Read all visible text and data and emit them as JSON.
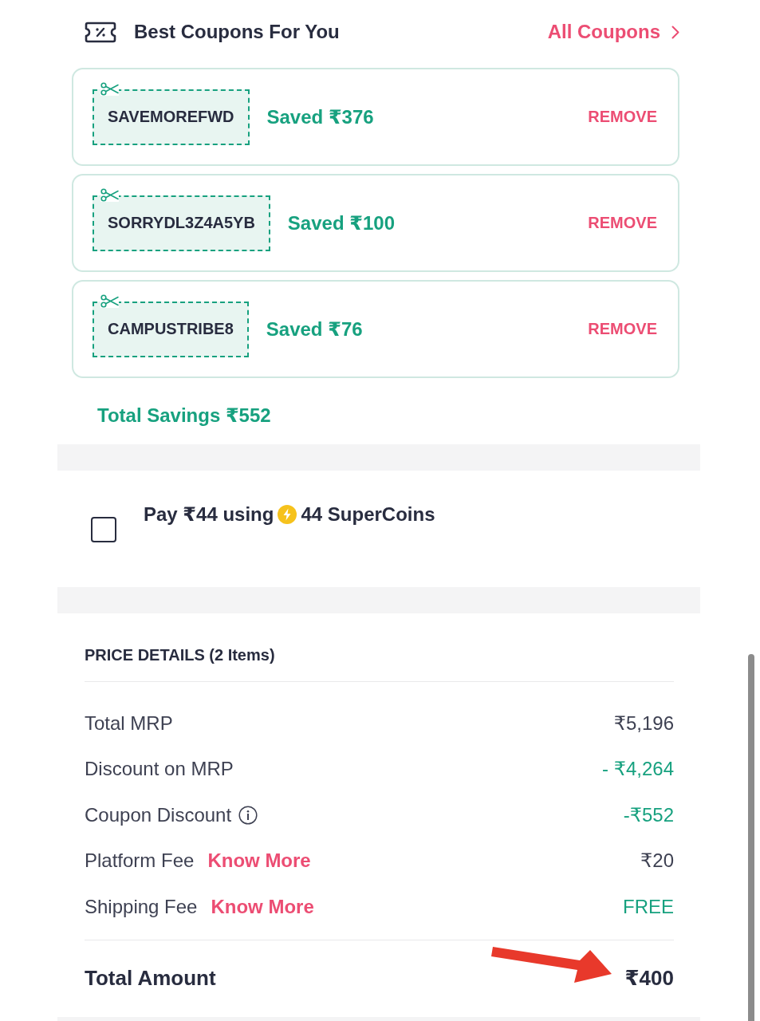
{
  "coupons_header": {
    "title": "Best Coupons For You",
    "link": "All Coupons"
  },
  "applied_coupons": [
    {
      "code": "SAVEMOREFWD",
      "saving": "Saved ₹376",
      "action": "REMOVE"
    },
    {
      "code": "SORRYDL3Z4A5YB",
      "saving": "Saved ₹100",
      "action": "REMOVE"
    },
    {
      "code": "CAMPUSTRIBE8",
      "saving": "Saved ₹76",
      "action": "REMOVE"
    }
  ],
  "total_savings": "Total Savings ₹552",
  "supercoins": {
    "checked": false,
    "text_before": "Pay ₹44 using",
    "text_after": "44 SuperCoins"
  },
  "price_details": {
    "title": "PRICE DETAILS (2 Items)",
    "rows": [
      {
        "label": "Total MRP",
        "value": "₹5,196",
        "kind": "plain",
        "info": false
      },
      {
        "label": "Discount on MRP",
        "value": "- ₹4,264",
        "kind": "saving",
        "info": false
      },
      {
        "label": "Coupon Discount",
        "value": "-₹552",
        "kind": "saving",
        "info": true
      },
      {
        "label": "Platform Fee",
        "link": "Know More",
        "value": "₹20",
        "kind": "plain",
        "info": false
      },
      {
        "label": "Shipping Fee",
        "link": "Know More",
        "value": "FREE",
        "kind": "saving",
        "info": false
      }
    ],
    "total": {
      "label": "Total Amount",
      "value": "₹400"
    }
  }
}
